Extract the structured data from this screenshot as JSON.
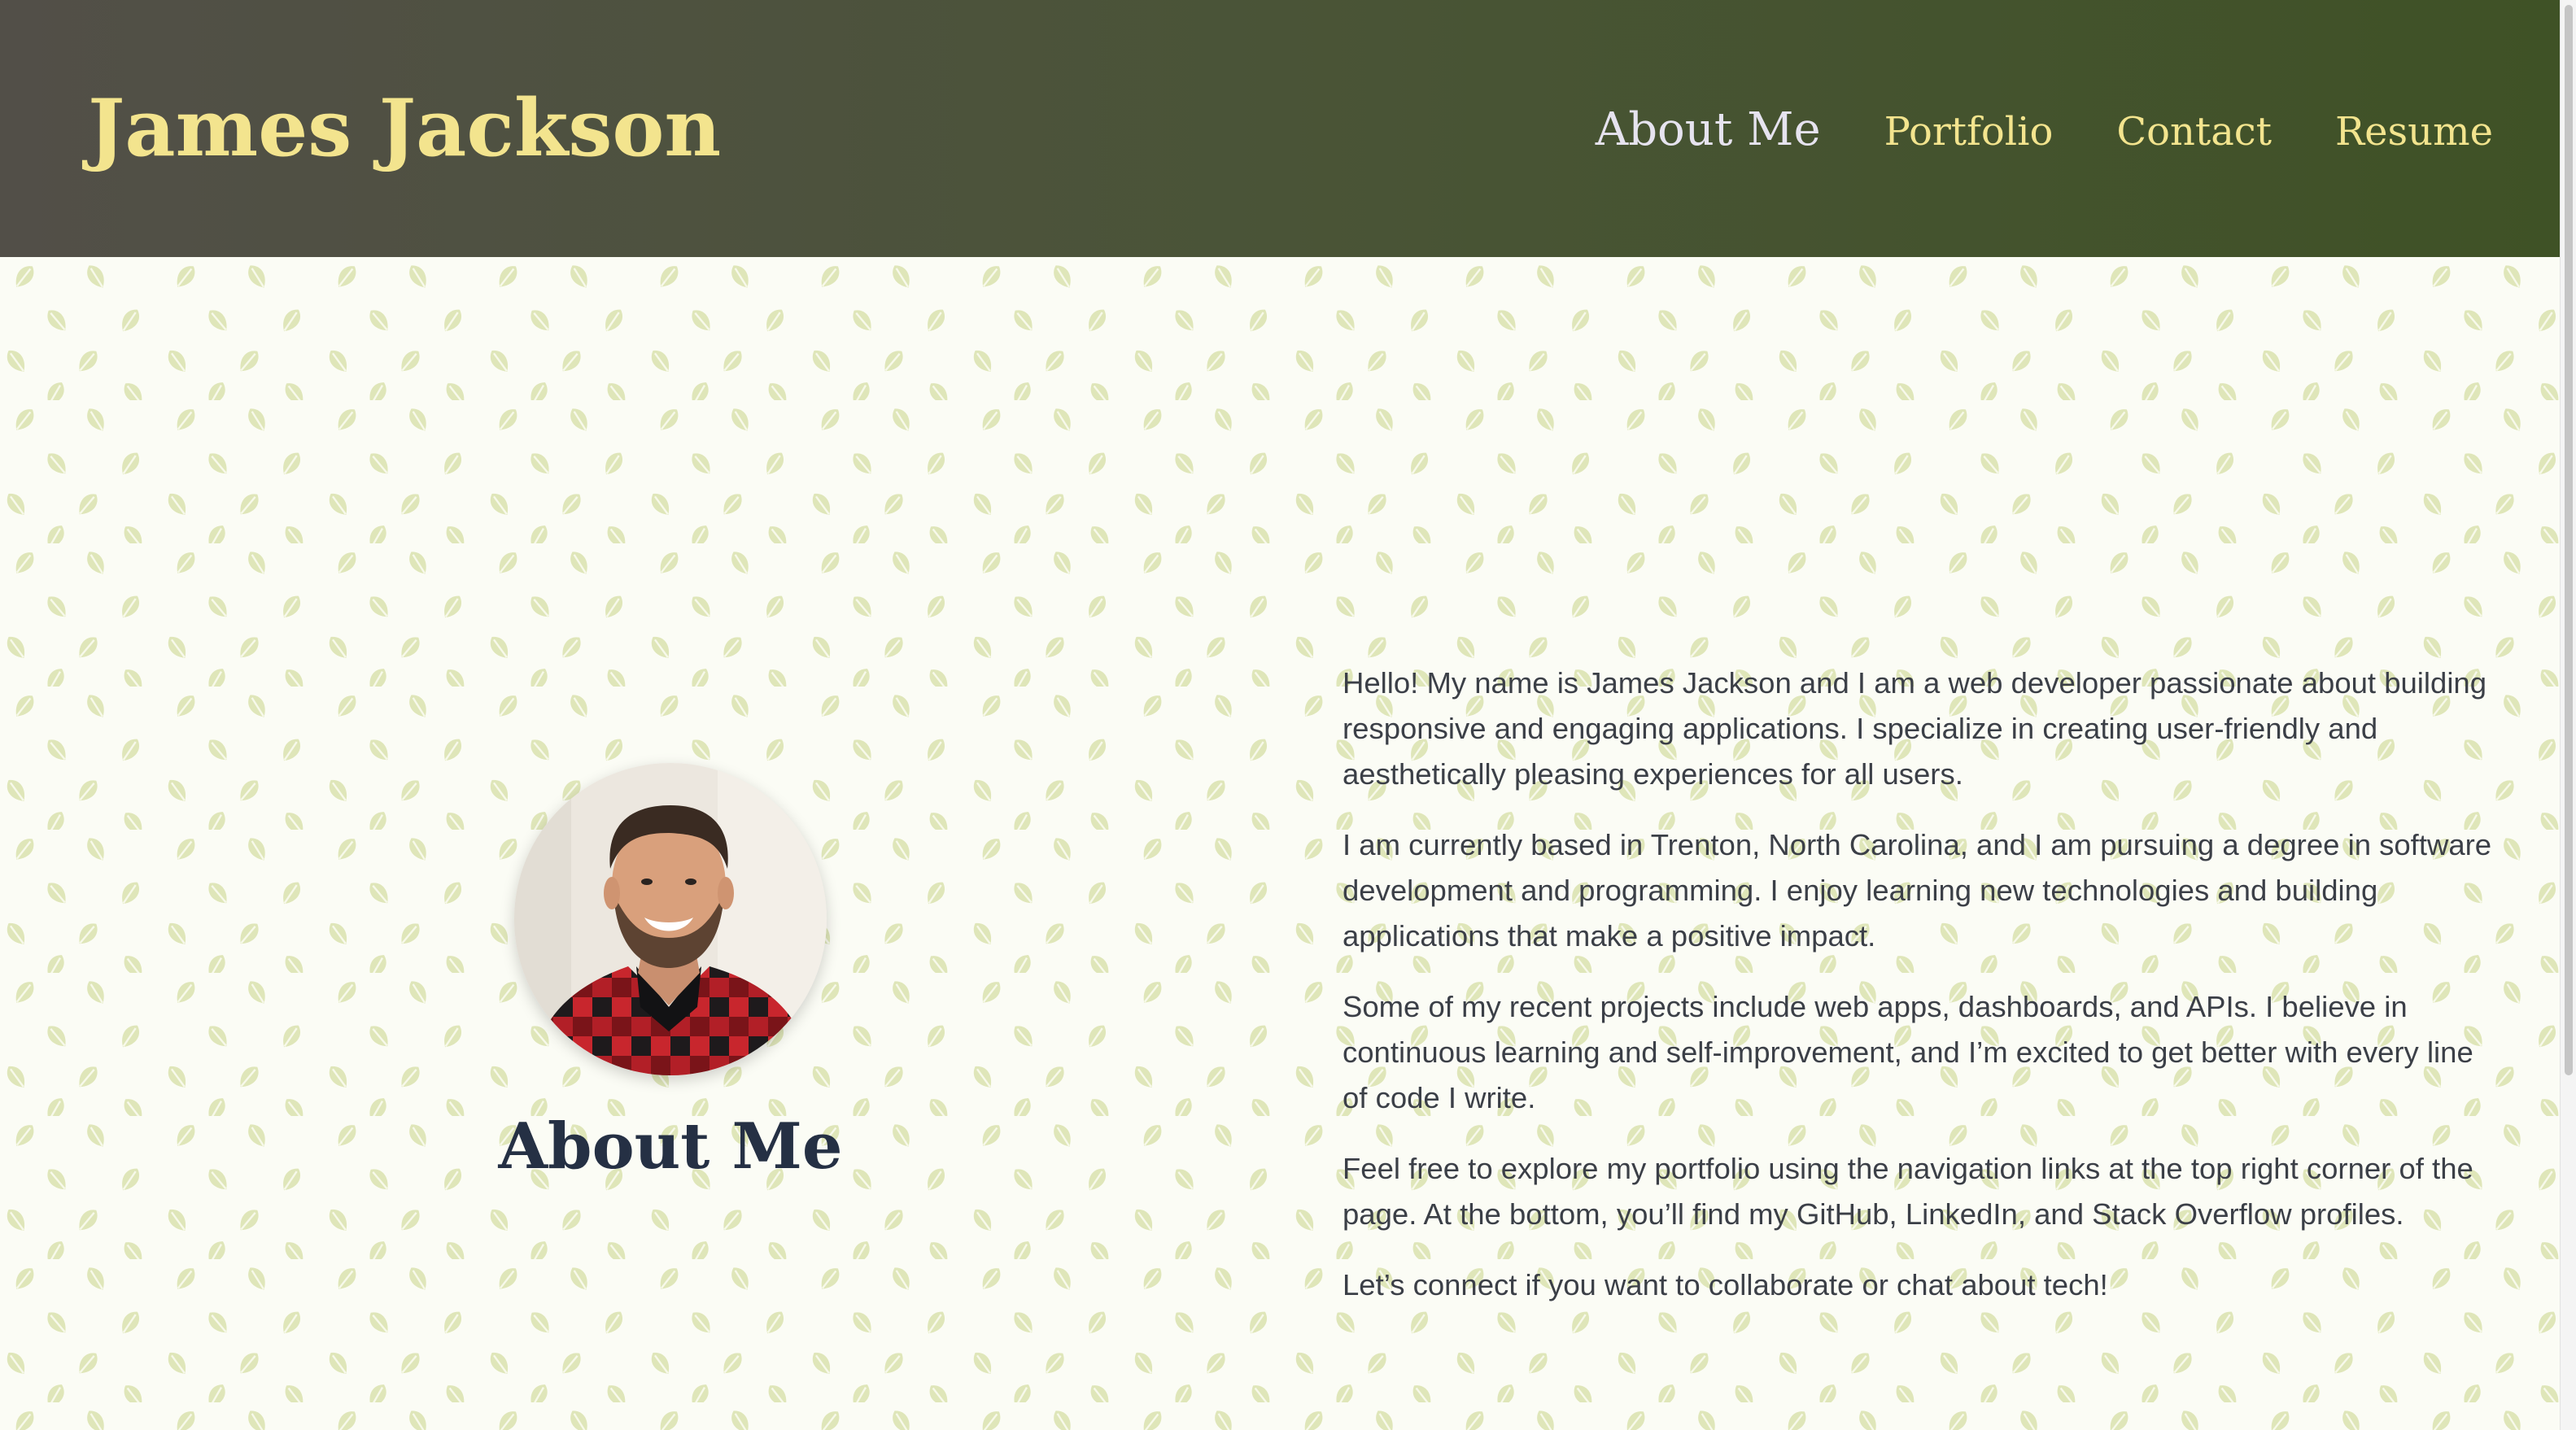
{
  "header": {
    "site_title": "James Jackson",
    "nav": [
      {
        "label": "About Me",
        "active": true
      },
      {
        "label": "Portfolio",
        "active": false
      },
      {
        "label": "Contact",
        "active": false
      },
      {
        "label": "Resume",
        "active": false
      }
    ]
  },
  "about": {
    "heading": "About Me",
    "paragraphs": [
      "Hello! My name is James Jackson and I am a web developer passionate about building responsive and engaging applications. I specialize in creating user-friendly and aesthetically pleasing experiences for all users.",
      "I am currently based in Trenton, North Carolina, and I am pursuing a degree in software development and programming. I enjoy learning new technologies and building applications that make a positive impact.",
      "Some of my recent projects include web apps, dashboards, and APIs. I believe in continuous learning and self-improvement, and I’m excited to get better with every line of code I write.",
      "Feel free to explore my portfolio using the navigation links at the top right corner of the page. At the bottom, you’ll find my GitHub, LinkedIn, and Stack Overflow profiles.",
      "Let’s connect if you want to collaborate or chat about tech!"
    ]
  },
  "colors": {
    "header_gradient_start": "#524f48",
    "header_gradient_end": "#3f5226",
    "title_color": "#f3e48e",
    "active_nav_color": "#e6e3ef",
    "heading_color": "#253044",
    "body_text_color": "#3b3f47",
    "page_background": "#fbfcf5",
    "leaf_pattern_color": "#d8e0b0"
  },
  "icons": {
    "pattern": "leaf-icon",
    "avatar": "profile-photo"
  }
}
